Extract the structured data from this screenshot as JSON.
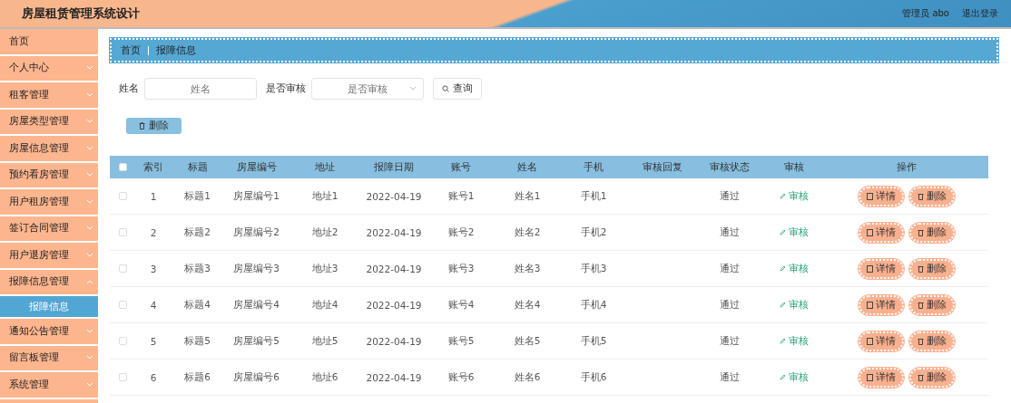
{
  "header": {
    "title": "房屋租赁管理系统设计",
    "user": "管理员 abo",
    "logout": "退出登录"
  },
  "sidebar": {
    "items": [
      {
        "label": "首页",
        "expandable": false
      },
      {
        "label": "个人中心",
        "expandable": true,
        "expanded": false
      },
      {
        "label": "租客管理",
        "expandable": true,
        "expanded": false
      },
      {
        "label": "房屋类型管理",
        "expandable": true,
        "expanded": false
      },
      {
        "label": "房屋信息管理",
        "expandable": true,
        "expanded": false
      },
      {
        "label": "预约看房管理",
        "expandable": true,
        "expanded": false
      },
      {
        "label": "用户租房管理",
        "expandable": true,
        "expanded": false
      },
      {
        "label": "签订合同管理",
        "expandable": true,
        "expanded": false
      },
      {
        "label": "用户退房管理",
        "expandable": true,
        "expanded": false
      },
      {
        "label": "报障信息管理",
        "expandable": true,
        "expanded": true,
        "children": [
          {
            "label": "报障信息",
            "selected": true
          }
        ]
      },
      {
        "label": "通知公告管理",
        "expandable": true,
        "expanded": false
      },
      {
        "label": "留言板管理",
        "expandable": true,
        "expanded": false
      },
      {
        "label": "系统管理",
        "expandable": true,
        "expanded": false
      }
    ]
  },
  "breadcrumb": [
    "首页",
    "报障信息"
  ],
  "search": {
    "fields": [
      {
        "label": "姓名",
        "placeholder": "姓名",
        "kind": "input"
      },
      {
        "label": "是否审核",
        "placeholder": "是否审核",
        "kind": "select"
      }
    ],
    "button": "查询"
  },
  "actions": {
    "delete": "删除"
  },
  "table": {
    "all_checked": false,
    "columns": [
      "索引",
      "标题",
      "房屋编号",
      "地址",
      "报障日期",
      "账号",
      "姓名",
      "手机",
      "审核回复",
      "审核状态",
      "审核",
      "操作"
    ],
    "rows": [
      {
        "checked": false,
        "cells": [
          "1",
          "标题1",
          "房屋编号1",
          "地址1",
          "2022-04-19",
          "账号1",
          "姓名1",
          "手机1",
          "",
          "通过"
        ],
        "review": "审核",
        "detail": "详情",
        "delete": "删除"
      },
      {
        "checked": false,
        "cells": [
          "2",
          "标题2",
          "房屋编号2",
          "地址2",
          "2022-04-19",
          "账号2",
          "姓名2",
          "手机2",
          "",
          "通过"
        ],
        "review": "审核",
        "detail": "详情",
        "delete": "删除"
      },
      {
        "checked": false,
        "cells": [
          "3",
          "标题3",
          "房屋编号3",
          "地址3",
          "2022-04-19",
          "账号3",
          "姓名3",
          "手机3",
          "",
          "通过"
        ],
        "review": "审核",
        "detail": "详情",
        "delete": "删除"
      },
      {
        "checked": false,
        "cells": [
          "4",
          "标题4",
          "房屋编号4",
          "地址4",
          "2022-04-19",
          "账号4",
          "姓名4",
          "手机4",
          "",
          "通过"
        ],
        "review": "审核",
        "detail": "详情",
        "delete": "删除"
      },
      {
        "checked": false,
        "cells": [
          "5",
          "标题5",
          "房屋编号5",
          "地址5",
          "2022-04-19",
          "账号5",
          "姓名5",
          "手机5",
          "",
          "通过"
        ],
        "review": "审核",
        "detail": "详情",
        "delete": "删除"
      },
      {
        "checked": false,
        "cells": [
          "6",
          "标题6",
          "房屋编号6",
          "地址6",
          "2022-04-19",
          "账号6",
          "姓名6",
          "手机6",
          "",
          "通过"
        ],
        "review": "审核",
        "detail": "详情",
        "delete": "删除"
      }
    ]
  }
}
